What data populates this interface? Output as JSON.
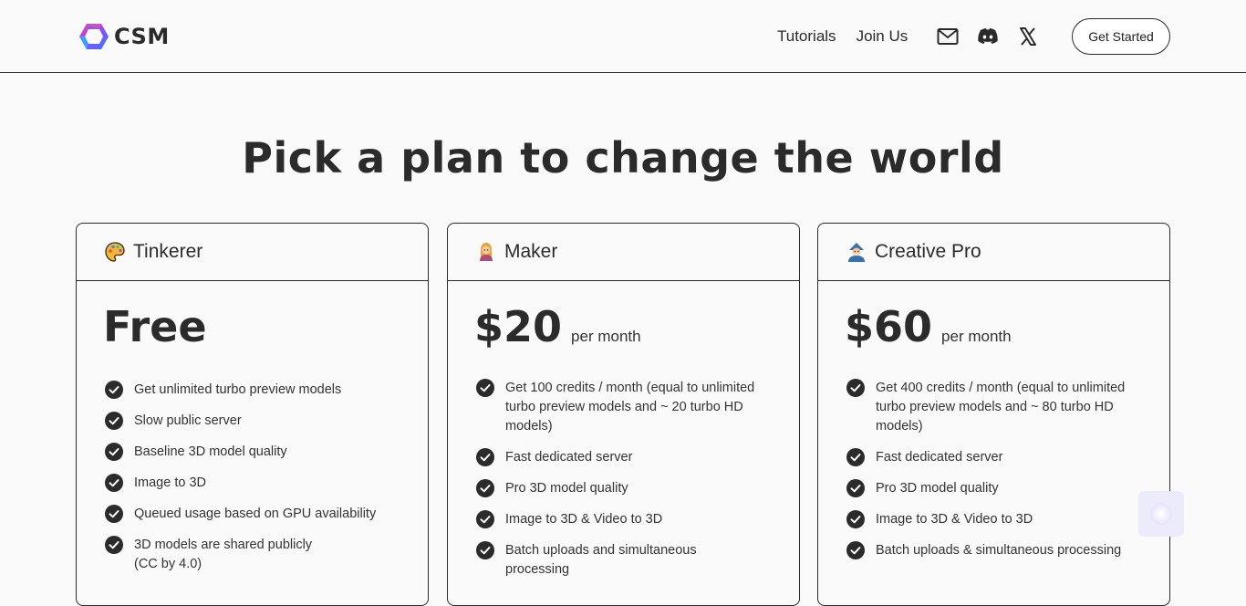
{
  "brand": {
    "name": "CSM"
  },
  "nav": {
    "tutorials": "Tutorials",
    "join_us": "Join Us",
    "icons": [
      "mail-icon",
      "discord-icon",
      "x-icon"
    ],
    "cta": "Get Started"
  },
  "hero": {
    "title": "Pick a plan to change the world"
  },
  "plans": [
    {
      "emoji": "palette",
      "name": "Tinkerer",
      "price": "Free",
      "period": "",
      "features": [
        "Get unlimited turbo preview models",
        "Slow public server",
        "Baseline 3D model quality",
        "Image to 3D",
        "Queued usage based on GPU availability",
        "3D models are shared publicly (CC by 4.0)"
      ]
    },
    {
      "emoji": "person",
      "name": "Maker",
      "price": "$20",
      "period": "per month",
      "features": [
        "Get 100 credits / month (equal to unlimited turbo preview models and ~ 20 turbo HD models)",
        "Fast dedicated server",
        "Pro 3D model quality",
        "Image to 3D & Video to 3D",
        "Batch uploads and simultaneous processing"
      ]
    },
    {
      "emoji": "mage",
      "name": "Creative Pro",
      "price": "$60",
      "period": "per month",
      "features": [
        "Get 400 credits / month (equal to unlimited turbo preview models and ~ 80 turbo HD models)",
        "Fast dedicated server",
        "Pro 3D model quality",
        "Image to 3D & Video to 3D",
        "Batch uploads & simultaneous processing"
      ]
    }
  ],
  "colors": {
    "text": "#2b2b2b",
    "background": "#fafafa",
    "chat_bubble": "#ecebfb"
  }
}
